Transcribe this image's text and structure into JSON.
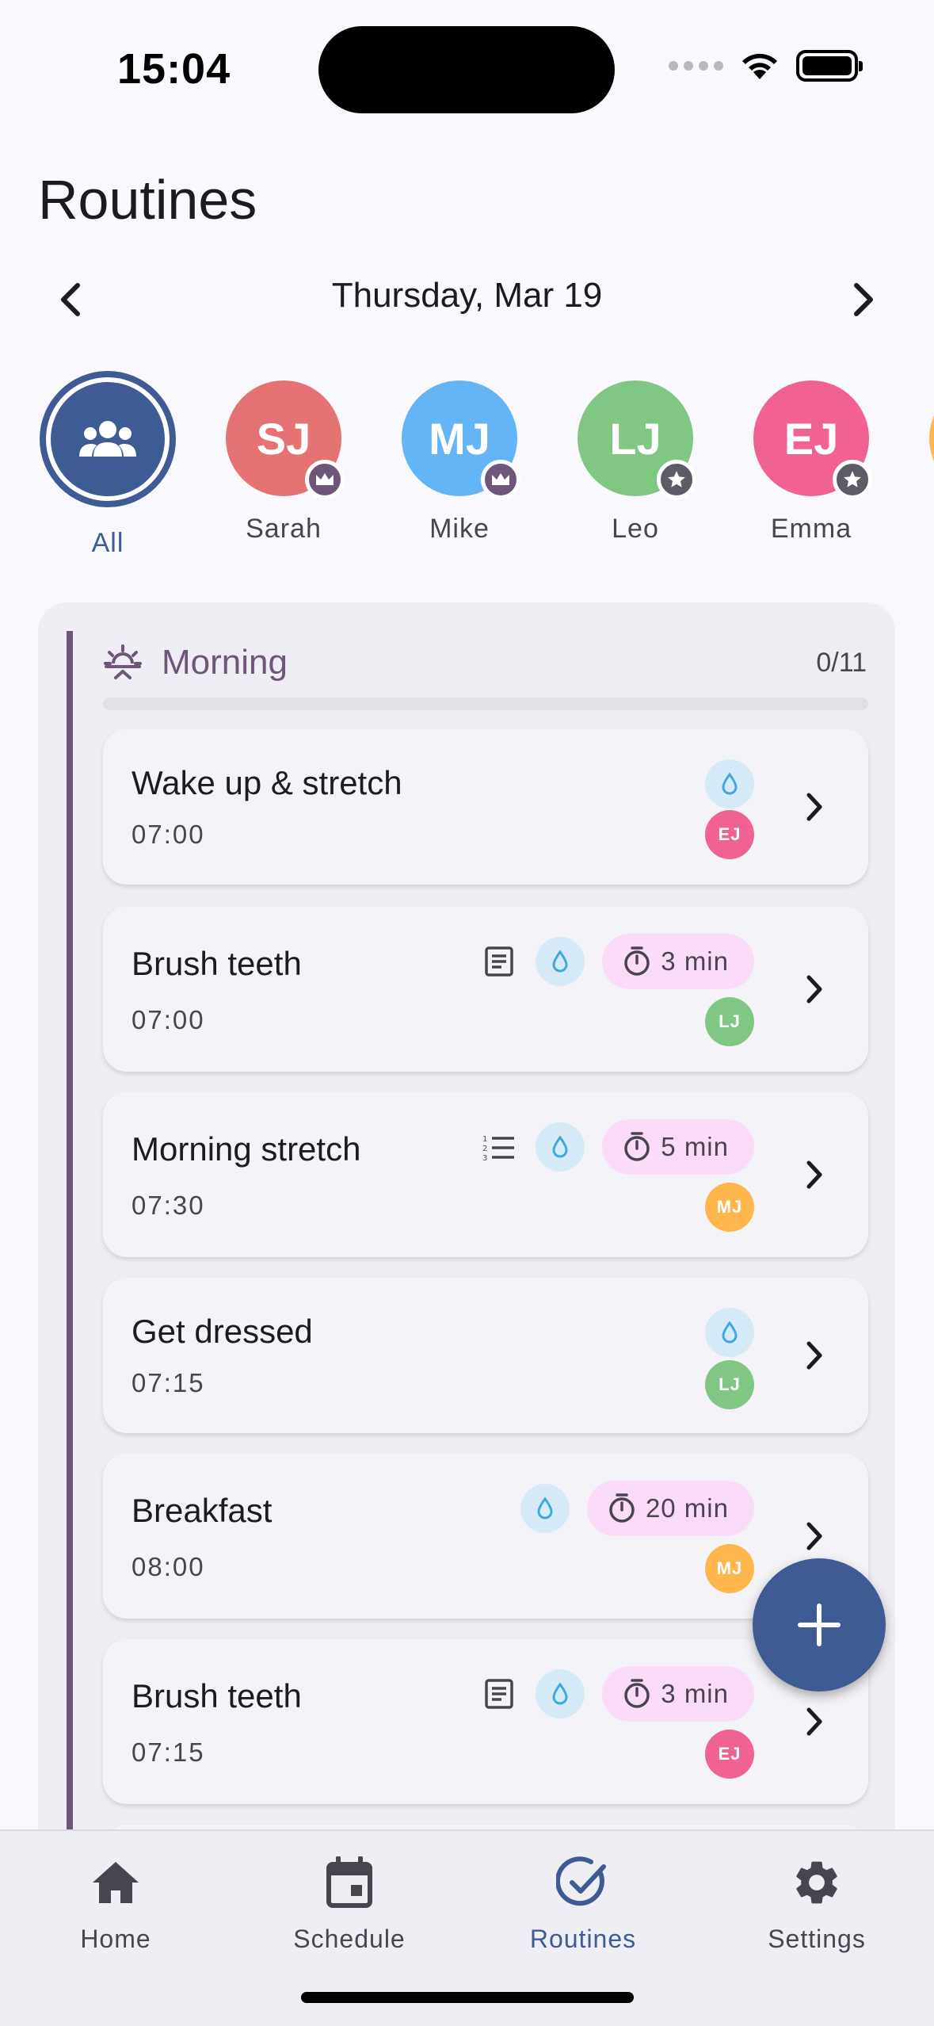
{
  "status": {
    "time": "15:04"
  },
  "page": {
    "title": "Routines"
  },
  "date_nav": {
    "label": "Thursday, Mar 19"
  },
  "members": [
    {
      "label": "All",
      "initials": "",
      "color": "#3F5B94",
      "selected": true
    },
    {
      "label": "Sarah",
      "initials": "SJ",
      "color": "#E57373",
      "badge": "crown-icon"
    },
    {
      "label": "Mike",
      "initials": "MJ",
      "color": "#64B5F6",
      "badge": "crown-icon"
    },
    {
      "label": "Leo",
      "initials": "LJ",
      "color": "#81C784",
      "badge": "star-icon"
    },
    {
      "label": "Emma",
      "initials": "EJ",
      "color": "#F06292",
      "badge": "star-icon"
    }
  ],
  "section": {
    "title": "Morning",
    "count": "0/11",
    "progress": 0,
    "accent": "#6E5678"
  },
  "routines": [
    {
      "title": "Wake up & stretch",
      "time": "07:00",
      "assignee": "EJ",
      "assignee_color": "#F06292",
      "doc": "",
      "timer": ""
    },
    {
      "title": "Brush teeth",
      "time": "07:00",
      "assignee": "LJ",
      "assignee_color": "#81C784",
      "doc": "notes-icon",
      "timer": "3 min"
    },
    {
      "title": "Morning stretch",
      "time": "07:30",
      "assignee": "MJ",
      "assignee_color": "#FFB74D",
      "doc": "checklist-icon",
      "timer": "5 min"
    },
    {
      "title": "Get dressed",
      "time": "07:15",
      "assignee": "LJ",
      "assignee_color": "#81C784",
      "doc": "",
      "timer": ""
    },
    {
      "title": "Breakfast",
      "time": "08:00",
      "assignee": "MJ",
      "assignee_color": "#FFB74D",
      "doc": "",
      "timer": "20 min"
    },
    {
      "title": "Brush teeth",
      "time": "07:15",
      "assignee": "EJ",
      "assignee_color": "#F06292",
      "doc": "notes-icon",
      "timer": "3 min"
    }
  ],
  "nav": {
    "home": "Home",
    "schedule": "Schedule",
    "routines": "Routines",
    "settings": "Settings",
    "active": "routines"
  },
  "colors": {
    "primary": "#3F5B94",
    "water_badge": "#D6EAF8",
    "timer_badge": "#FADCF8"
  }
}
